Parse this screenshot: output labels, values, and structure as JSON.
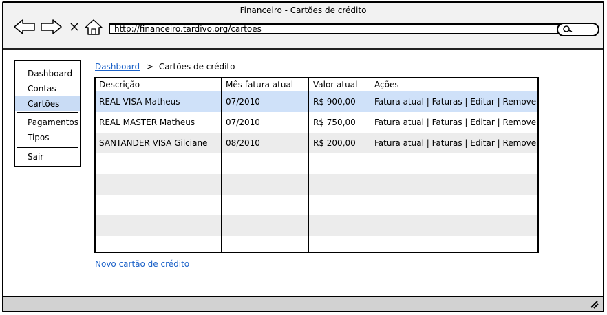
{
  "window": {
    "title": "Financeiro - Cartões de crédito",
    "url": "http://financeiro.tardivo.org/cartoes"
  },
  "sidebar": {
    "items": [
      {
        "label": "Dashboard"
      },
      {
        "label": "Contas"
      },
      {
        "label": "Cartões",
        "active": true
      },
      {
        "label": "Pagamentos"
      },
      {
        "label": "Tipos"
      },
      {
        "label": "Sair"
      }
    ]
  },
  "breadcrumb": {
    "link": "Dashboard",
    "separator": ">",
    "current": "Cartões de crédito"
  },
  "table": {
    "columns": [
      "Descrição",
      "Mês fatura atual",
      "Valor atual",
      "Ações"
    ],
    "rows": [
      {
        "descricao": "REAL VISA Matheus",
        "mes": "07/2010",
        "valor": "R$ 900,00",
        "acoes": "Fatura atual | Faturas | Editar | Remover"
      },
      {
        "descricao": "REAL MASTER Matheus",
        "mes": "07/2010",
        "valor": "R$ 750,00",
        "acoes": "Fatura atual | Faturas | Editar | Remover"
      },
      {
        "descricao": "SANTANDER VISA Gilciane",
        "mes": "08/2010",
        "valor": "R$ 200,00",
        "acoes": "Fatura atual | Faturas | Editar | Remover"
      }
    ]
  },
  "new_card_link": "Novo cartão de crédito",
  "colors": {
    "selected_row": "#cfe1f9",
    "link": "#1d63c9",
    "alt_row": "#ececec"
  },
  "icons": [
    "back-arrow-icon",
    "forward-arrow-icon",
    "close-icon",
    "home-icon",
    "search-icon",
    "resize-grip-icon"
  ]
}
